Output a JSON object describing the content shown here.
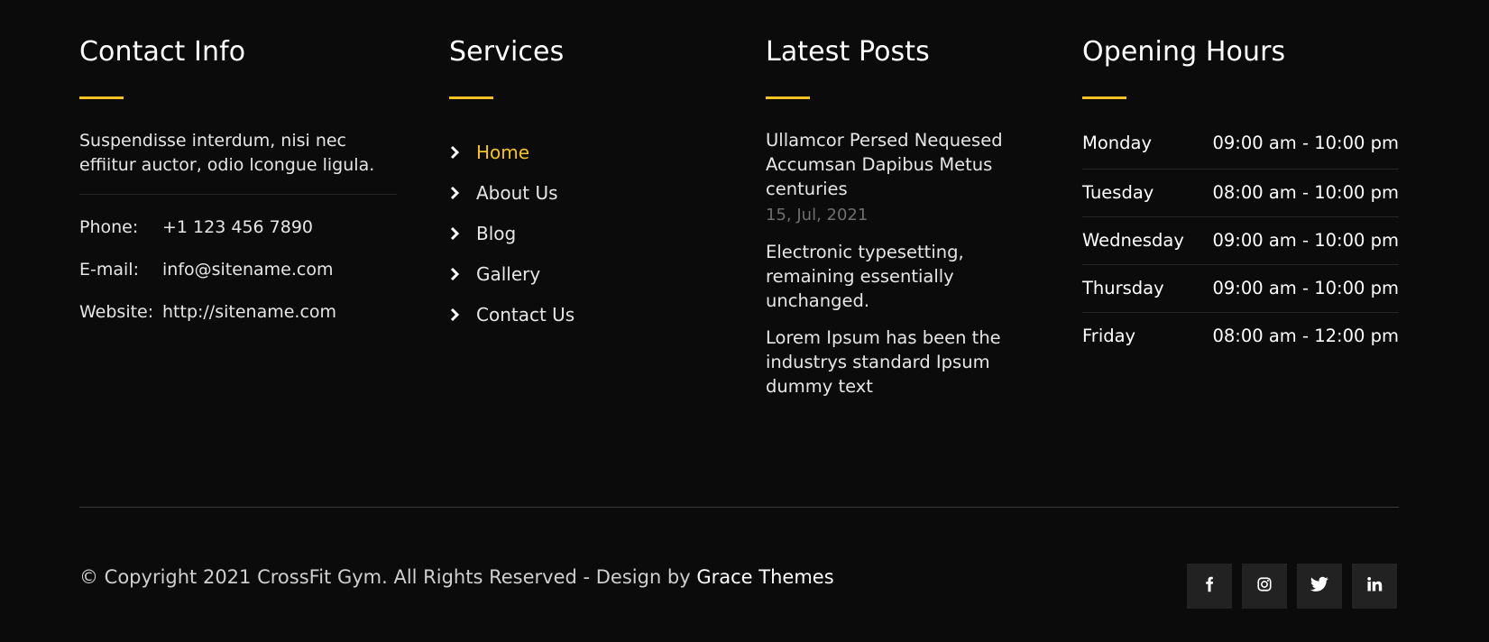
{
  "contact": {
    "title": "Contact Info",
    "description": "Suspendisse interdum, nisi nec effiitur auctor, odio lcongue ligula.",
    "rows": [
      {
        "label": "Phone:",
        "value": "+1 123 456 7890"
      },
      {
        "label": "E-mail:",
        "value": "info@sitename.com"
      },
      {
        "label": "Website:",
        "value": "http://sitename.com"
      }
    ]
  },
  "services": {
    "title": "Services",
    "items": [
      {
        "label": "Home",
        "active": true
      },
      {
        "label": "About Us"
      },
      {
        "label": "Blog"
      },
      {
        "label": "Gallery"
      },
      {
        "label": "Contact Us"
      }
    ]
  },
  "posts": {
    "title": "Latest Posts",
    "items": [
      {
        "title": "Ullamcor Persed Nequesed Accumsan Dapibus Metus centuries",
        "date": "15, Jul, 2021"
      },
      {
        "title": "Electronic typesetting, remaining essentially unchanged."
      },
      {
        "title": "Lorem Ipsum has been the industrys standard Ipsum dummy text"
      }
    ]
  },
  "hours": {
    "title": "Opening Hours",
    "rows": [
      {
        "day": "Monday",
        "time": "09:00 am - 10:00 pm"
      },
      {
        "day": "Tuesday",
        "time": "08:00 am - 10:00 pm"
      },
      {
        "day": "Wednesday",
        "time": "09:00 am - 10:00 pm"
      },
      {
        "day": "Thursday",
        "time": "09:00 am - 10:00 pm"
      },
      {
        "day": "Friday",
        "time": "08:00 am - 12:00 pm"
      }
    ]
  },
  "footer": {
    "copyright_prefix": "© Copyright 2021 CrossFit Gym. All Rights Reserved - Design by ",
    "brand": "Grace Themes",
    "social": [
      "facebook-icon",
      "instagram-icon",
      "twitter-icon",
      "linkedin-icon"
    ]
  },
  "colors": {
    "background": "#0b0b0b",
    "accent": "#f6c223",
    "social_bg": "#222222"
  }
}
